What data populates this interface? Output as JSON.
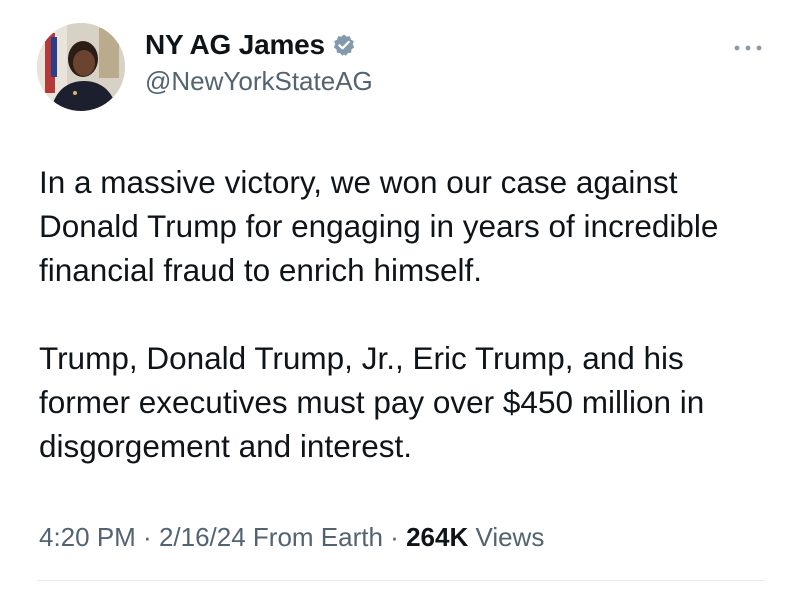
{
  "author": {
    "display_name": "NY AG James",
    "handle": "@NewYorkStateAG",
    "verified": true
  },
  "icons": {
    "verified": "verified-badge-icon",
    "more": "more-options-icon"
  },
  "tweet": {
    "paragraphs": [
      "In a massive victory, we won our case against Donald Trump for engaging in years of incredible financial fraud to enrich himself.",
      "Trump, Donald Trump, Jr., Eric Trump, and his former executives must pay over $450 million in disgorgement and interest."
    ]
  },
  "meta": {
    "time": "4:20 PM",
    "separator": " · ",
    "date": "2/16/24",
    "source": "From Earth",
    "views_count": "264K",
    "views_label": "Views"
  },
  "colors": {
    "text": "#0f1419",
    "secondary_text": "#536471",
    "verified_badge": "#829aab",
    "divider": "#e7e9ea"
  }
}
